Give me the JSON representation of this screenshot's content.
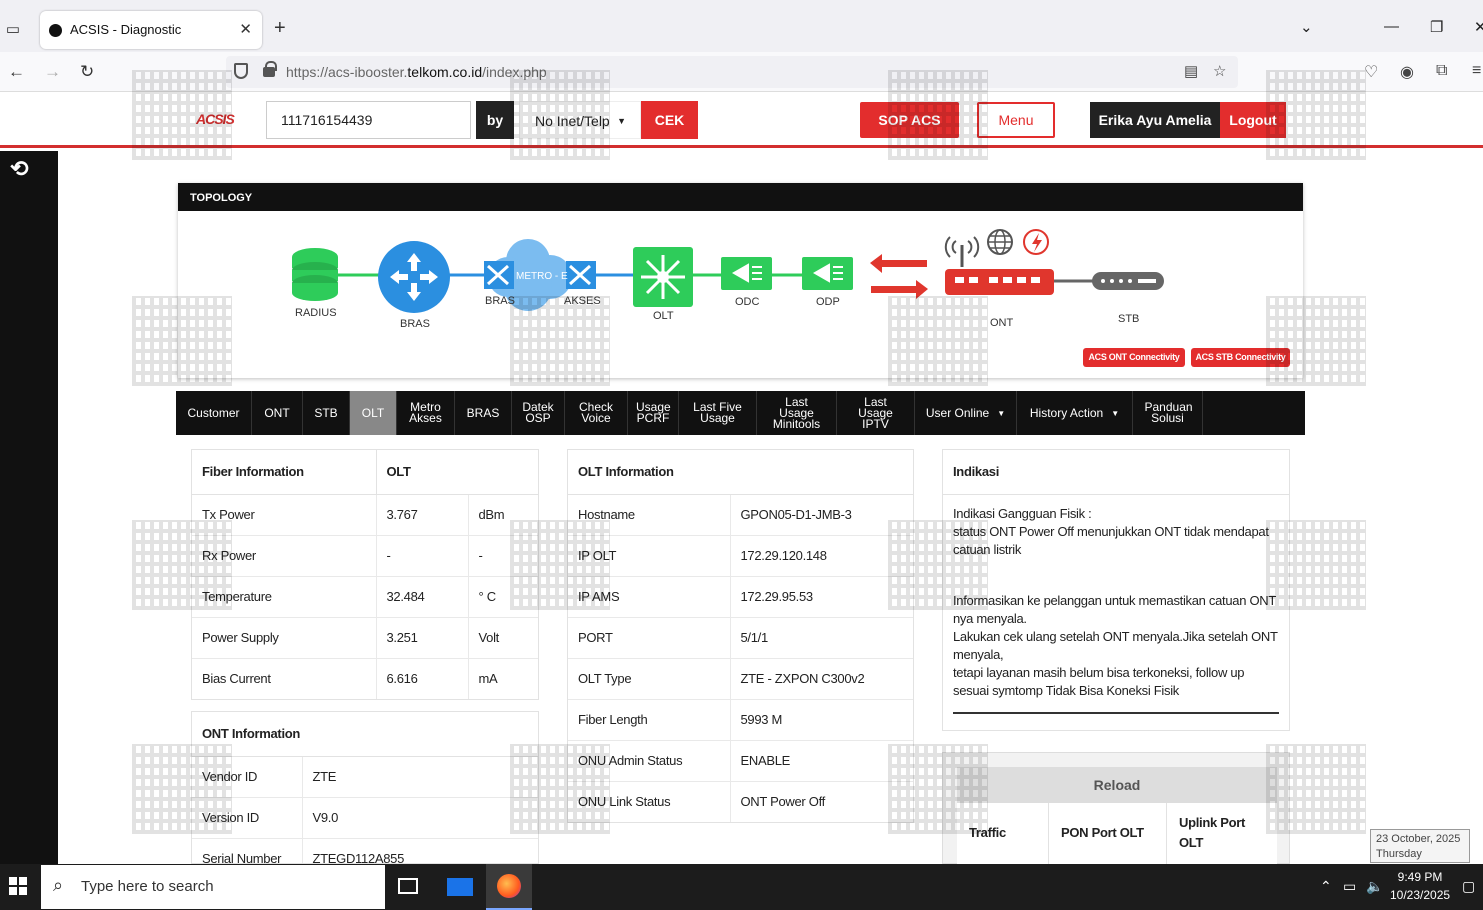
{
  "browser": {
    "tab_title": "ACSIS - Diagnostic",
    "url_prefix": "https://acs-ibooster.",
    "url_domain": "telkom.co.id",
    "url_path": "/index.php"
  },
  "header": {
    "logo": "ACSIS",
    "search_value": "111716154439",
    "by_label": "by",
    "by_select": "No Inet/Telp",
    "cek_label": "CEK",
    "sop_label": "SOP ACS",
    "menu_label": "Menu",
    "user_name": "Erika Ayu Amelia",
    "logout_label": "Logout"
  },
  "topology": {
    "title": "TOPOLOGY",
    "nodes": {
      "radius": "RADIUS",
      "bras": "BRAS",
      "bras_small": "BRAS",
      "metro": "METRO - E",
      "akses": "AKSES",
      "olt": "OLT",
      "odc": "ODC",
      "odp": "ODP",
      "ont": "ONT",
      "stb": "STB"
    },
    "acs_ont": "ACS ONT Connectivity",
    "acs_stb": "ACS STB Connectivity",
    "colors": {
      "green": "#2ecc5a",
      "blue": "#2b8fe0",
      "red": "#e0362d",
      "gray": "#666666"
    }
  },
  "tabs": [
    {
      "label": "Customer"
    },
    {
      "label": "ONT"
    },
    {
      "label": "STB"
    },
    {
      "label": "OLT",
      "active": true
    },
    {
      "label": "Metro Akses"
    },
    {
      "label": "BRAS"
    },
    {
      "label": "Datek OSP"
    },
    {
      "label": "Check Voice"
    },
    {
      "label": "Usage PCRF"
    },
    {
      "label": "Last Five Usage"
    },
    {
      "label": "Last Usage Minitools"
    },
    {
      "label": "Last Usage IPTV"
    },
    {
      "label": "User Online",
      "dropdown": true
    },
    {
      "label": "History Action",
      "dropdown": true
    },
    {
      "label": "Panduan Solusi"
    }
  ],
  "fiber": {
    "header": [
      "Fiber Information",
      "OLT"
    ],
    "rows": [
      [
        "Tx Power",
        "3.767",
        "dBm"
      ],
      [
        "Rx Power",
        "-",
        "-"
      ],
      [
        "Temperature",
        "32.484",
        "° C"
      ],
      [
        "Power Supply",
        "3.251",
        "Volt"
      ],
      [
        "Bias Current",
        "6.616",
        "mA"
      ]
    ]
  },
  "ont_info": {
    "header": "ONT Information",
    "rows": [
      [
        "Vendor ID",
        "ZTE"
      ],
      [
        "Version ID",
        "V9.0"
      ],
      [
        "Serial Number",
        "ZTEGD112A855"
      ]
    ]
  },
  "olt_info": {
    "header": "OLT Information",
    "rows": [
      [
        "Hostname",
        "GPON05-D1-JMB-3"
      ],
      [
        "IP OLT",
        "172.29.120.148"
      ],
      [
        "IP AMS",
        "172.29.95.53"
      ],
      [
        "PORT",
        "5/1/1"
      ],
      [
        "OLT Type",
        "ZTE - ZXPON C300v2"
      ],
      [
        "Fiber Length",
        "5993 M"
      ],
      [
        "ONU Admin Status",
        "ENABLE"
      ],
      [
        "ONU Link Status",
        "ONT Power Off"
      ]
    ]
  },
  "indikasi": {
    "header": "Indikasi",
    "line1": "Indikasi Gangguan Fisik :",
    "line2": "status ONT Power Off menunjukkan ONT tidak mendapat catuan listrik",
    "line3": "Informasikan ke pelanggan untuk memastikan catuan ONT nya menyala.",
    "line4": "Lakukan cek ulang setelah ONT menyala.Jika setelah ONT menyala,",
    "line5": "tetapi layanan masih belum bisa terkoneksi, follow up sesuai symtomp Tidak Bisa Koneksi Fisik"
  },
  "reload": {
    "label": "Reload",
    "cols": [
      "Traffic",
      "PON Port OLT",
      "Uplink Port OLT"
    ]
  },
  "taskbar": {
    "search_placeholder": "Type here to search",
    "time": "9:49 PM",
    "date": "10/23/2025",
    "tooltip_date": "23 October, 2025",
    "tooltip_day": "Thursday"
  }
}
